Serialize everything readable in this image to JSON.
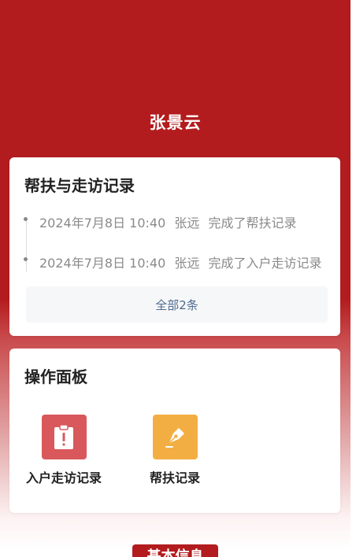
{
  "header": {
    "user_name": "张景云"
  },
  "records": {
    "title": "帮扶与走访记录",
    "items": [
      {
        "time": "2024年7月8日 10:40",
        "person": "张远",
        "action": "完成了帮扶记录"
      },
      {
        "time": "2024年7月8日 10:40",
        "person": "张远",
        "action": "完成了入户走访记录"
      }
    ],
    "more_label": "全部2条"
  },
  "operations": {
    "title": "操作面板",
    "items": [
      {
        "label": "入户走访记录",
        "icon": "clipboard-alert-icon",
        "color": "#d9585b"
      },
      {
        "label": "帮扶记录",
        "icon": "pen-nib-icon",
        "color": "#f3ae43"
      }
    ]
  },
  "bottom_tab": {
    "label": "基本信息"
  },
  "colors": {
    "brand_red": "#b31c1e",
    "link_blue": "#4e6a8f"
  }
}
